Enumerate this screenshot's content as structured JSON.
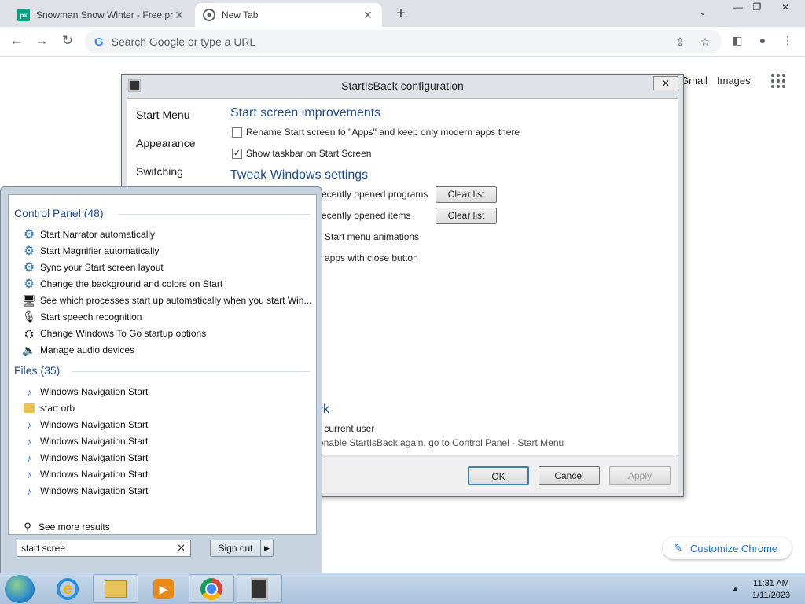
{
  "browser": {
    "tabs": [
      {
        "title": "Snowman Snow Winter - Free ph",
        "favicon": "px",
        "active": false
      },
      {
        "title": "New Tab",
        "active": true
      }
    ],
    "omnibox_placeholder": "Search Google or type a URL",
    "google_g": "G",
    "links": {
      "gmail": "Gmail",
      "images": "Images"
    },
    "customize_label": "Customize Chrome"
  },
  "dialog": {
    "title": "StartIsBack configuration",
    "sidebar": [
      "Start Menu",
      "Appearance",
      "Switching"
    ],
    "sections": {
      "start_screen": "Start screen improvements",
      "tweak": "Tweak Windows settings",
      "partial": "ck"
    },
    "options": {
      "rename_start": "Rename Start screen to \"Apps\" and keep only modern apps there",
      "show_taskbar": "Show taskbar on Start Screen",
      "recent_programs": "ecently opened programs",
      "recent_items": "ecently opened items",
      "animations": "Start menu animations",
      "close_button": "apps with close button",
      "current_user": "r current user",
      "enable_note": "enable StartIsBack again, go to Control Panel - Start Menu"
    },
    "checked": {
      "rename_start": false,
      "show_taskbar": true
    },
    "clear_list": "Clear list",
    "buttons": {
      "ok": "OK",
      "cancel": "Cancel",
      "apply": "Apply"
    }
  },
  "start_menu": {
    "control_panel_header": "Control Panel (48)",
    "control_panel_items": [
      {
        "label": "Start Narrator automatically",
        "icon": "gear-icon"
      },
      {
        "label": "Start Magnifier automatically",
        "icon": "gear-icon"
      },
      {
        "label": "Sync your Start screen layout",
        "icon": "gear-icon"
      },
      {
        "label": "Change the background and colors on Start",
        "icon": "gear-icon"
      },
      {
        "label": "See which processes start up automatically when you start Win...",
        "icon": "monitor-icon"
      },
      {
        "label": "Start speech recognition",
        "icon": "microphone-icon"
      },
      {
        "label": "Change Windows To Go startup options",
        "icon": "drive-icon"
      },
      {
        "label": "Manage audio devices",
        "icon": "speaker-icon"
      }
    ],
    "files_header": "Files (35)",
    "files_items": [
      {
        "label": "Windows Navigation Start",
        "icon": "audio-file-icon"
      },
      {
        "label": "start orb",
        "icon": "folder-icon"
      },
      {
        "label": "Windows Navigation Start",
        "icon": "audio-file-icon"
      },
      {
        "label": "Windows Navigation Start",
        "icon": "audio-file-icon"
      },
      {
        "label": "Windows Navigation Start",
        "icon": "audio-file-icon"
      },
      {
        "label": "Windows Navigation Start",
        "icon": "audio-file-icon"
      },
      {
        "label": "Windows Navigation Start",
        "icon": "audio-file-icon"
      }
    ],
    "see_more": "See more results",
    "search_value": "start scree",
    "sign_out": "Sign out"
  },
  "taskbar": {
    "time": "11:31 AM",
    "date": "1/11/2023"
  },
  "colors": {
    "accent_blue": "#1e4c9a",
    "chrome_blue": "#1a73e8"
  }
}
